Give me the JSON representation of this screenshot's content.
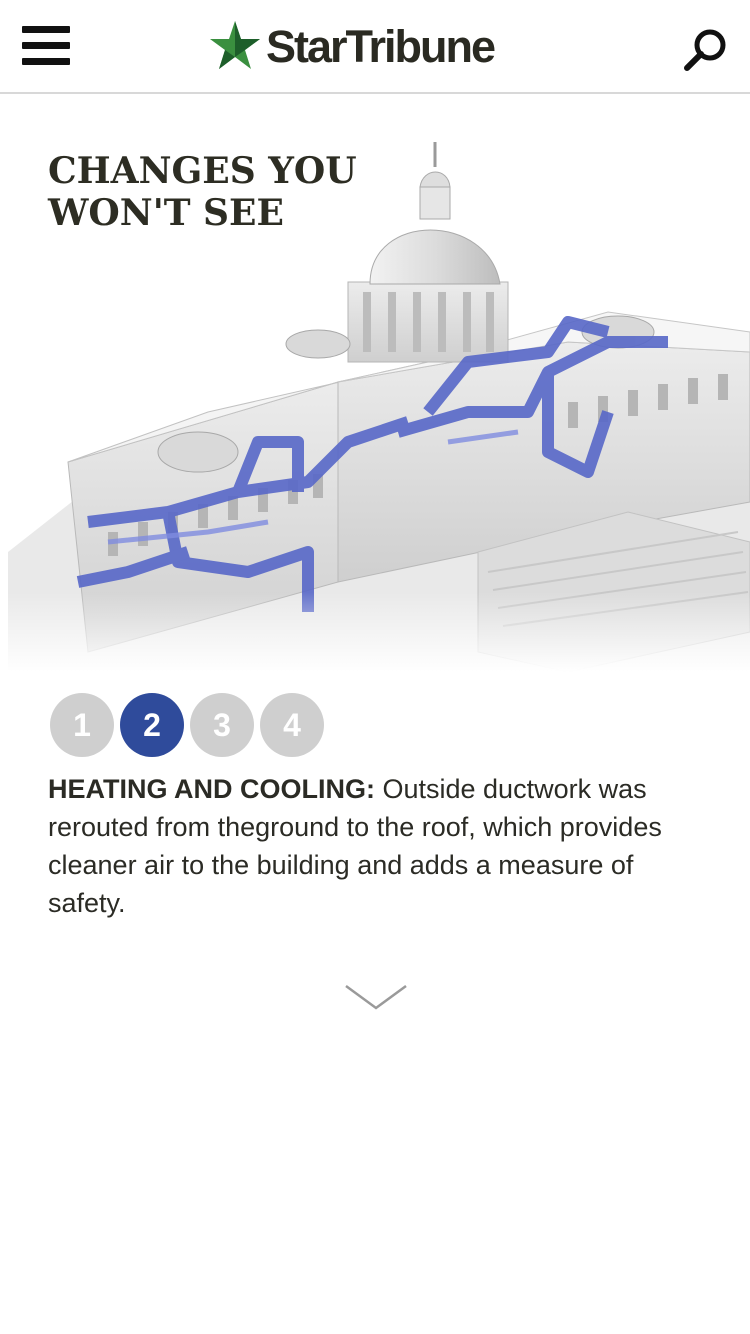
{
  "header": {
    "brand": "StarTribune",
    "colors": {
      "star": "#3a8f3f",
      "star_dark": "#1d5e2a",
      "text": "#2a2a22"
    }
  },
  "hero": {
    "title_line1": "CHANGES YOU",
    "title_line2": "WON'T SEE",
    "duct_color": "#5868c8"
  },
  "steps": {
    "items": [
      "1",
      "2",
      "3",
      "4"
    ],
    "active": "2",
    "active_color": "#2f4b9b",
    "inactive_color": "#cfcfcf"
  },
  "description": {
    "heading": "HEATING AND COOLING:",
    "body": " Outside ductwork was rerouted from theground to the roof, which provides cleaner air to the building and adds a measure of safety."
  },
  "icons": {
    "menu": "hamburger-icon",
    "search": "search-icon",
    "scroll": "chevron-down-icon"
  }
}
